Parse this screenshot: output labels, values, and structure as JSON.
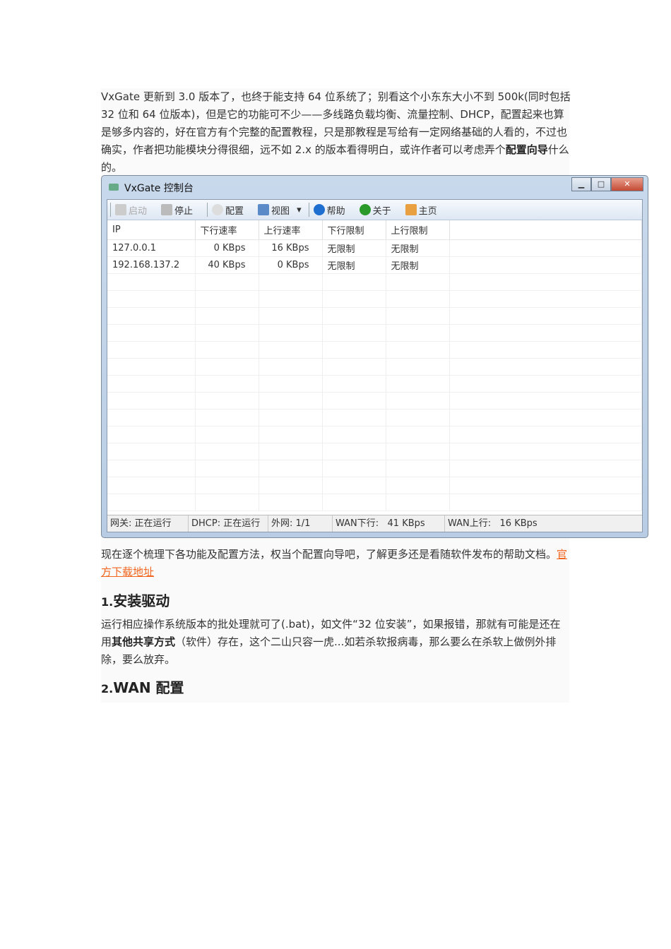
{
  "intro": [
    "VxGate 更新到 3.0 版本了，也终于能支持 64 位系统了；别看这个小东东大小不到 500k(同时包括 32 位和 64 位版本)，但是它的功能可不少——多线路负载均衡、流量控制、DHCP，配置起来也算是够多内容的，好在官方有个完整的配置教程，只是那教程是写给有一定网络基础的人看的，不过也确实，作者把功能模块分得很细，远不如 2.x 的版本看得明白，或许作者可以考虑弄个",
    "配置向导",
    "什么的。"
  ],
  "window": {
    "title": "VxGate 控制台",
    "toolbar": {
      "start": "启动",
      "stop": "停止",
      "config": "配置",
      "view": "视图",
      "help": "帮助",
      "about": "关于",
      "home": "主页"
    },
    "columns": [
      "IP",
      "下行速率",
      "上行速率",
      "下行限制",
      "上行限制"
    ],
    "rows": [
      [
        "127.0.0.1",
        "0 KBps",
        "16 KBps",
        "无限制",
        "无限制"
      ],
      [
        "192.168.137.2",
        "40 KBps",
        "0 KBps",
        "无限制",
        "无限制"
      ]
    ],
    "status": [
      "网关: 正在运行",
      "DHCP: 正在运行",
      "外网: 1/1",
      "WAN下行:   41 KBps",
      "WAN上行:   16 KBps"
    ]
  },
  "para2": "现在逐个梳理下各功能及配置方法，权当个配置向导吧，了解更多还是看随软件发布的帮助文档。",
  "link": "官方下载地址",
  "h1": {
    "num": "1.",
    "text": "安装驱动"
  },
  "para3": [
    "运行相应操作系统版本的批处理就可了(.bat)，如文件“32 位安装”，如果报错，那就有可能是还在用",
    "其他共享方式",
    "（软件）存在，这个二山只容一虎...如若杀软报病毒，那么要么在杀软上做例外排除，要么放弃。"
  ],
  "h2": {
    "num": "2.",
    "text": "WAN 配置"
  }
}
